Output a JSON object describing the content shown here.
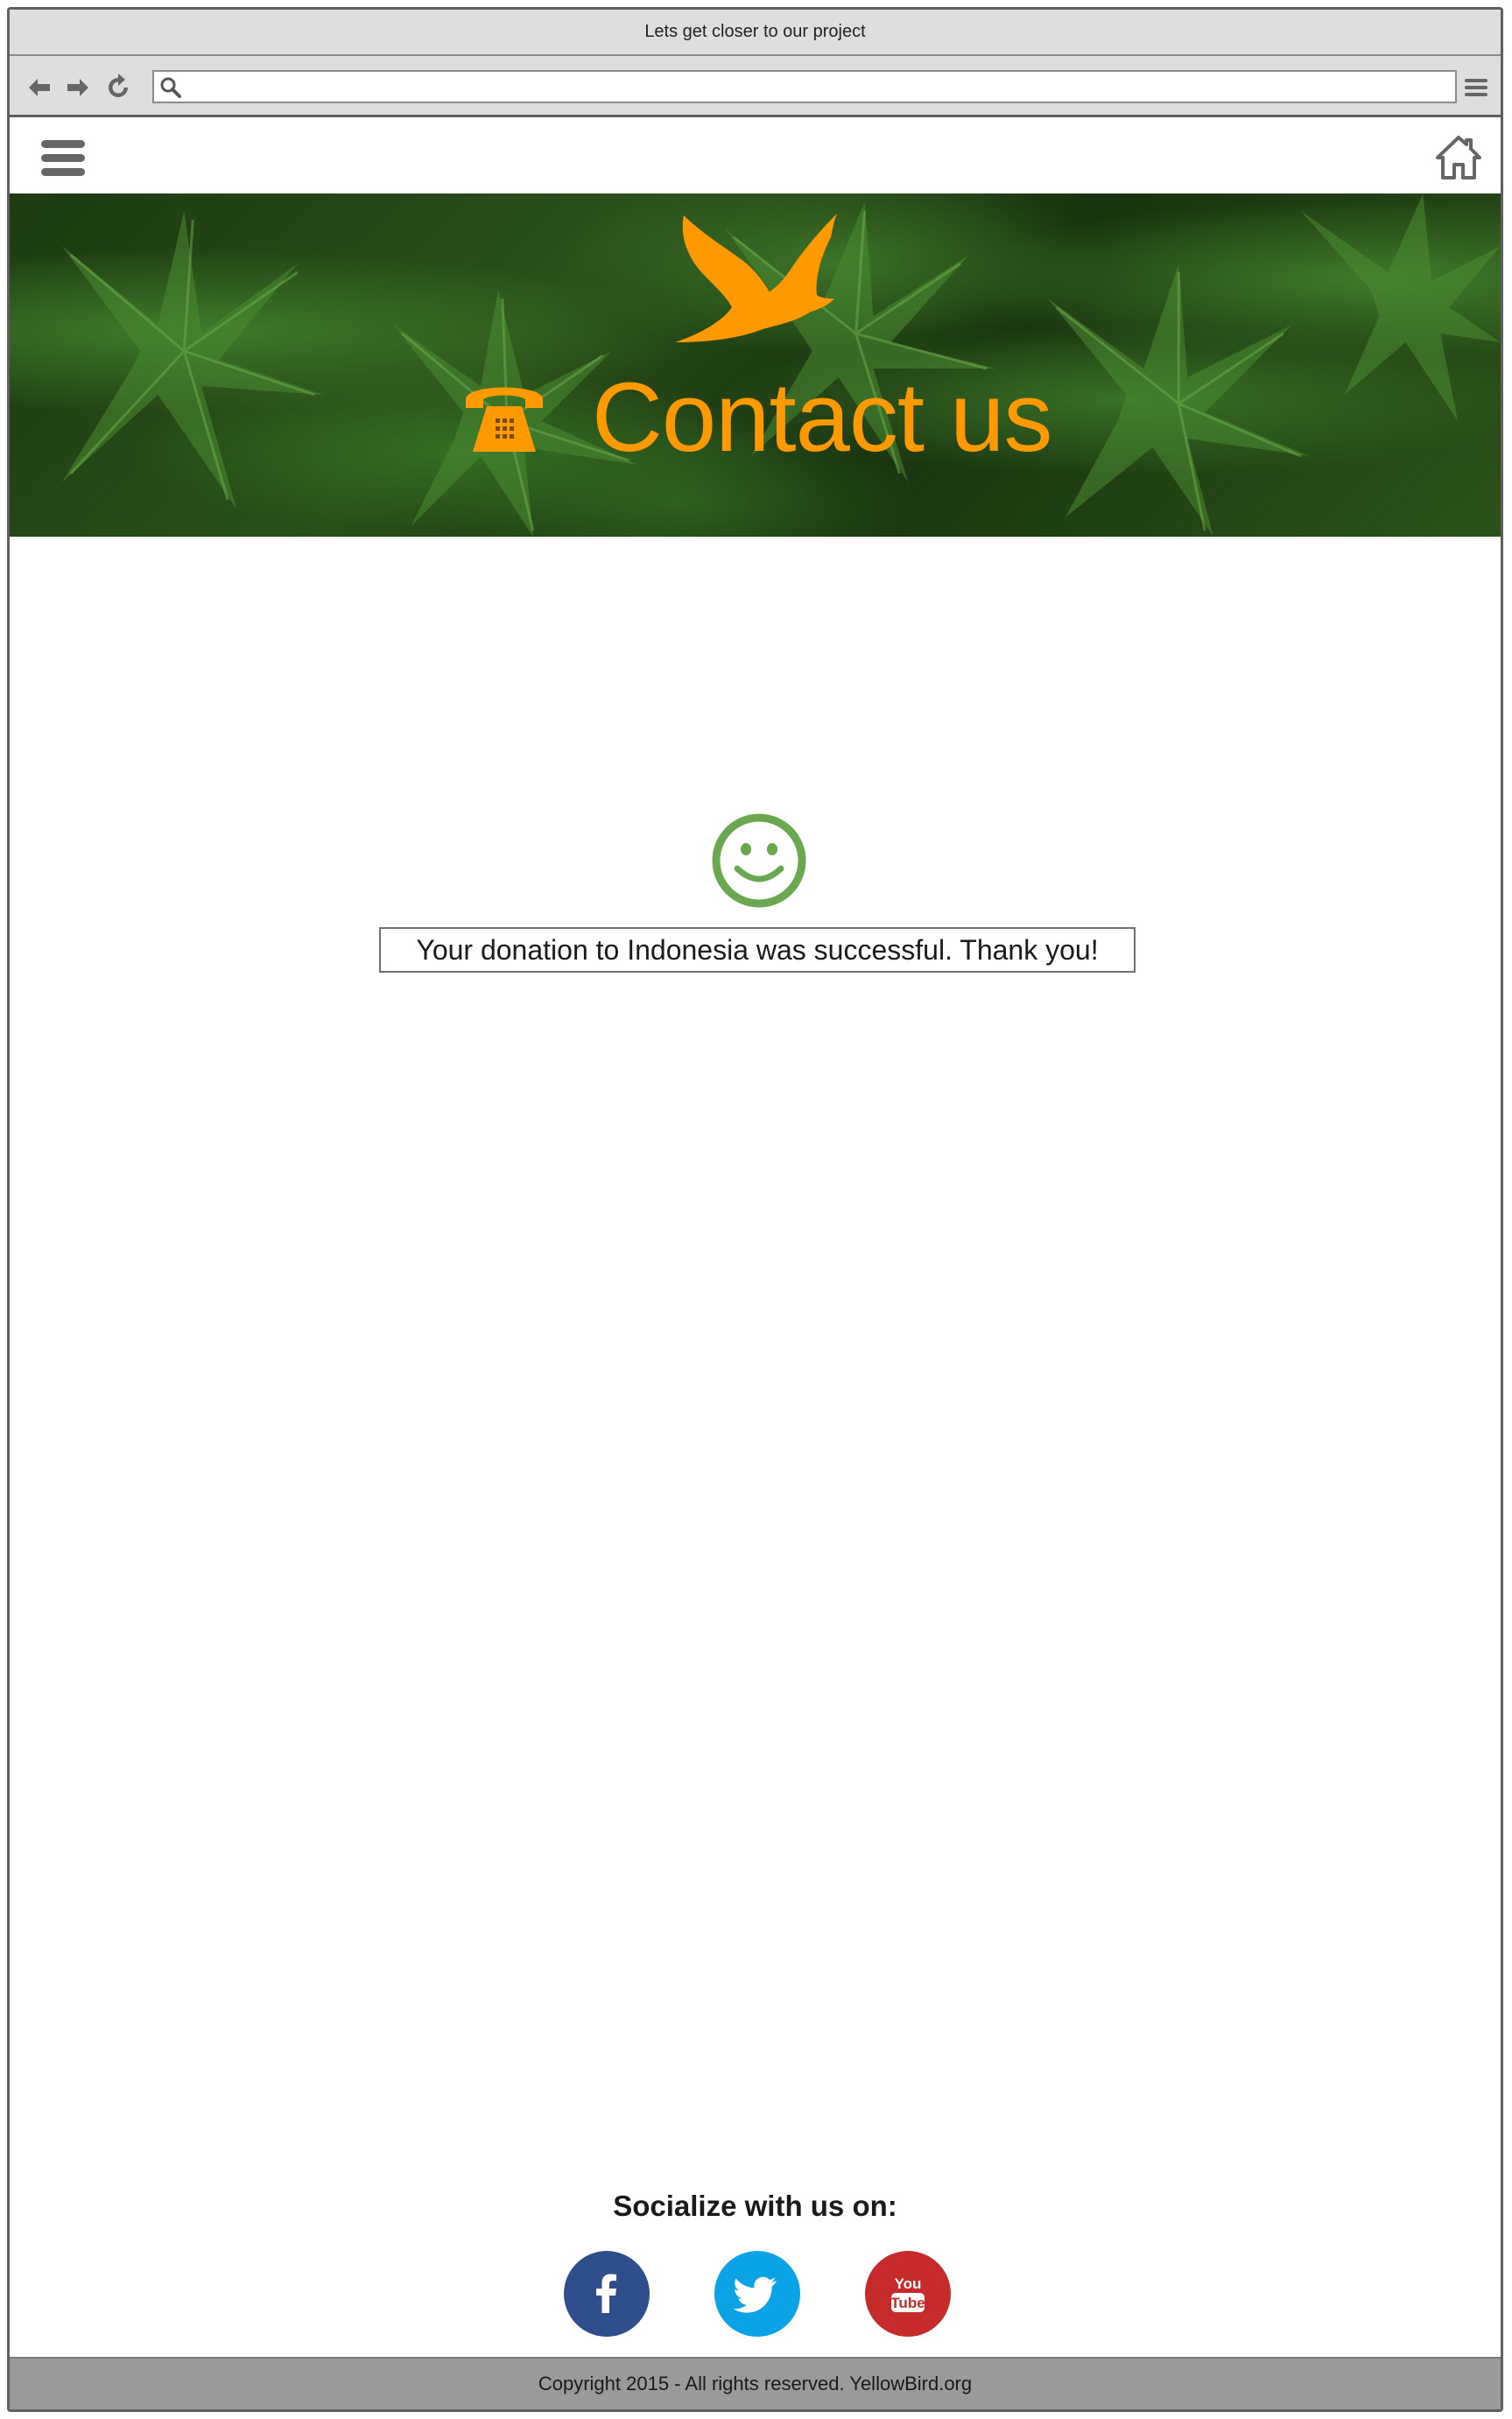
{
  "window": {
    "title": "Lets get closer to our project"
  },
  "browser": {
    "address_value": "",
    "icons": [
      "back-arrow-icon",
      "forward-arrow-icon",
      "refresh-icon",
      "search-icon",
      "browser-menu-icon"
    ]
  },
  "header": {
    "icons": [
      "hamburger-menu-icon",
      "home-icon"
    ]
  },
  "hero": {
    "title": "Contact us",
    "icons": [
      "bird-logo-icon",
      "telephone-icon"
    ],
    "accent_color": "#ff9900"
  },
  "message": {
    "text": "Your donation to Indonesia was successful. Thank you!",
    "icon": "smiley-icon",
    "icon_color": "#6aa84f"
  },
  "social": {
    "label": "Socialize with us on:",
    "links": [
      {
        "name": "facebook",
        "icon": "facebook-icon",
        "color": "#2f4e8c"
      },
      {
        "name": "twitter",
        "icon": "twitter-icon",
        "color": "#0aa3e6"
      },
      {
        "name": "youtube",
        "icon": "youtube-icon",
        "color": "#c62a2a",
        "glyph_top": "You",
        "glyph_bottom": "Tube"
      }
    ]
  },
  "footer": {
    "text": "Copyright 2015  - All rights reserved. YellowBird.org"
  }
}
